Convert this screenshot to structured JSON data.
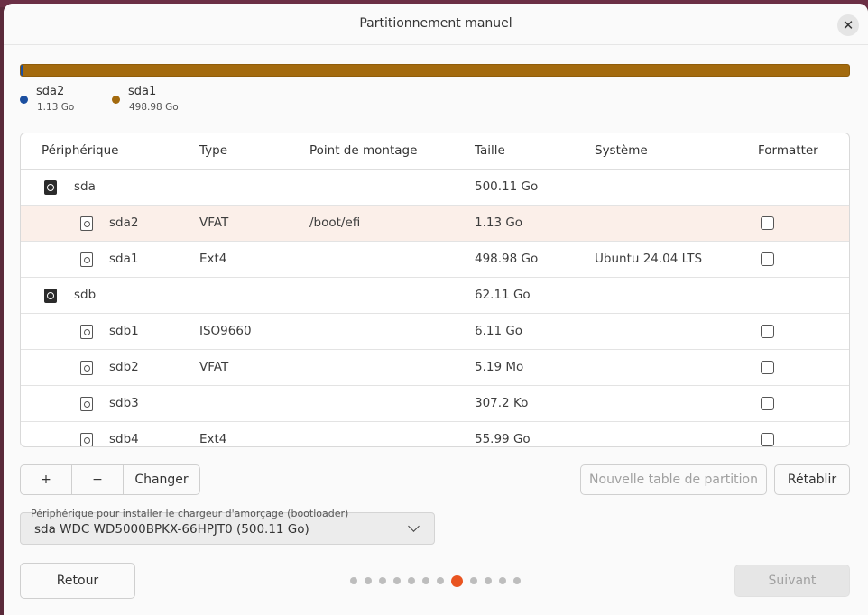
{
  "window": {
    "title": "Partitionnement manuel"
  },
  "usage": {
    "segments": [
      {
        "name": "sda2",
        "size": "1.13 Go",
        "color": "#1b4fa0",
        "fraction": 0.0023
      },
      {
        "name": "sda1",
        "size": "498.98 Go",
        "color": "#a36a0e",
        "fraction": 0.9977
      }
    ]
  },
  "table": {
    "headers": {
      "device": "Périphérique",
      "type": "Type",
      "mount": "Point de montage",
      "size": "Taille",
      "system": "Système",
      "format": "Formatter"
    },
    "rows": [
      {
        "kind": "disk",
        "device": "sda",
        "type": "",
        "mount": "",
        "size": "500.11 Go",
        "system": "",
        "formattable": false
      },
      {
        "kind": "partition",
        "device": "sda2",
        "type": "VFAT",
        "mount": "/boot/efi",
        "size": "1.13 Go",
        "system": "",
        "formattable": true,
        "selected": true
      },
      {
        "kind": "partition",
        "device": "sda1",
        "type": "Ext4",
        "mount": "",
        "size": "498.98 Go",
        "system": "Ubuntu 24.04 LTS",
        "formattable": true
      },
      {
        "kind": "disk",
        "device": "sdb",
        "type": "",
        "mount": "",
        "size": "62.11 Go",
        "system": "",
        "formattable": false
      },
      {
        "kind": "partition",
        "device": "sdb1",
        "type": "ISO9660",
        "mount": "",
        "size": "6.11 Go",
        "system": "",
        "formattable": true
      },
      {
        "kind": "partition",
        "device": "sdb2",
        "type": "VFAT",
        "mount": "",
        "size": "5.19 Mo",
        "system": "",
        "formattable": true
      },
      {
        "kind": "partition",
        "device": "sdb3",
        "type": "",
        "mount": "",
        "size": "307.2 Ko",
        "system": "",
        "formattable": true
      },
      {
        "kind": "partition",
        "device": "sdb4",
        "type": "Ext4",
        "mount": "",
        "size": "55.99 Go",
        "system": "",
        "formattable": true
      }
    ]
  },
  "toolbar": {
    "add_label": "+",
    "remove_label": "−",
    "change_label": "Changer",
    "new_table_label": "Nouvelle table de partition",
    "revert_label": "Rétablir"
  },
  "bootloader": {
    "label": "Périphérique pour installer le chargeur d'amorçage (bootloader)",
    "value": "sda WDC WD5000BPKX-66HPJT0 (500.11 Go)"
  },
  "footer": {
    "back_label": "Retour",
    "next_label": "Suivant",
    "steps_total": 12,
    "current_step": 8
  },
  "icons": {
    "close": "close-icon",
    "disk": "disk-icon",
    "partition": "partition-icon",
    "chevron": "chevron-down-icon"
  }
}
